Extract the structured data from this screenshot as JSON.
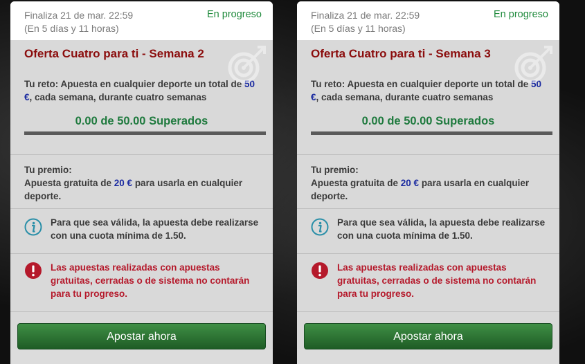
{
  "colors": {
    "accent_green": "#1f8a3c",
    "title_red": "#8b0d0d",
    "warning_red": "#b5192b",
    "amount_blue": "#1a2aa0",
    "button_green": "#2e7a35"
  },
  "cards": [
    {
      "ends_label": "Finaliza 21 de mar. 22:59",
      "remaining": "(En 5 días y 11 horas)",
      "status": "En progreso",
      "title": "Oferta Cuatro para ti - Semana 2",
      "challenge_pre": "Tu reto: Apuesta en cualquier deporte un total de ",
      "challenge_amount": "50 €",
      "challenge_post": ", cada semana, durante cuatro semanas",
      "progress_text": "0.00 de 50.00 Superados",
      "progress_fraction": 0,
      "prize_label": "Tu premio:",
      "prize_pre": "Apuesta gratuita de ",
      "prize_amount": "20 €",
      "prize_post": " para usarla en cualquier deporte.",
      "info_text": "Para que sea válida, la apuesta debe realizarse con una cuota mínima de 1.50.",
      "info_icon": "info-icon",
      "warning_text": "Las apuestas realizadas con apuestas gratuitas, cerradas o de sistema no contarán para tu progreso.",
      "warning_icon": "alert-icon",
      "button_label": "Apostar ahora"
    },
    {
      "ends_label": "Finaliza 21 de mar. 22:59",
      "remaining": "(En 5 días y 11 horas)",
      "status": "En progreso",
      "title": "Oferta Cuatro para ti - Semana 3",
      "challenge_pre": "Tu reto: Apuesta en cualquier deporte un total de ",
      "challenge_amount": "50 €",
      "challenge_post": ", cada semana, durante cuatro semanas",
      "progress_text": "0.00 de 50.00 Superados",
      "progress_fraction": 0,
      "prize_label": "Tu premio:",
      "prize_pre": "Apuesta gratuita de ",
      "prize_amount": "20 €",
      "prize_post": " para usarla en cualquier deporte.",
      "info_text": "Para que sea válida, la apuesta debe realizarse con una cuota mínima de 1.50.",
      "info_icon": "info-icon",
      "warning_text": "Las apuestas realizadas con apuestas gratuitas, cerradas o de sistema no contarán para tu progreso.",
      "warning_icon": "alert-icon",
      "button_label": "Apostar ahora"
    }
  ]
}
